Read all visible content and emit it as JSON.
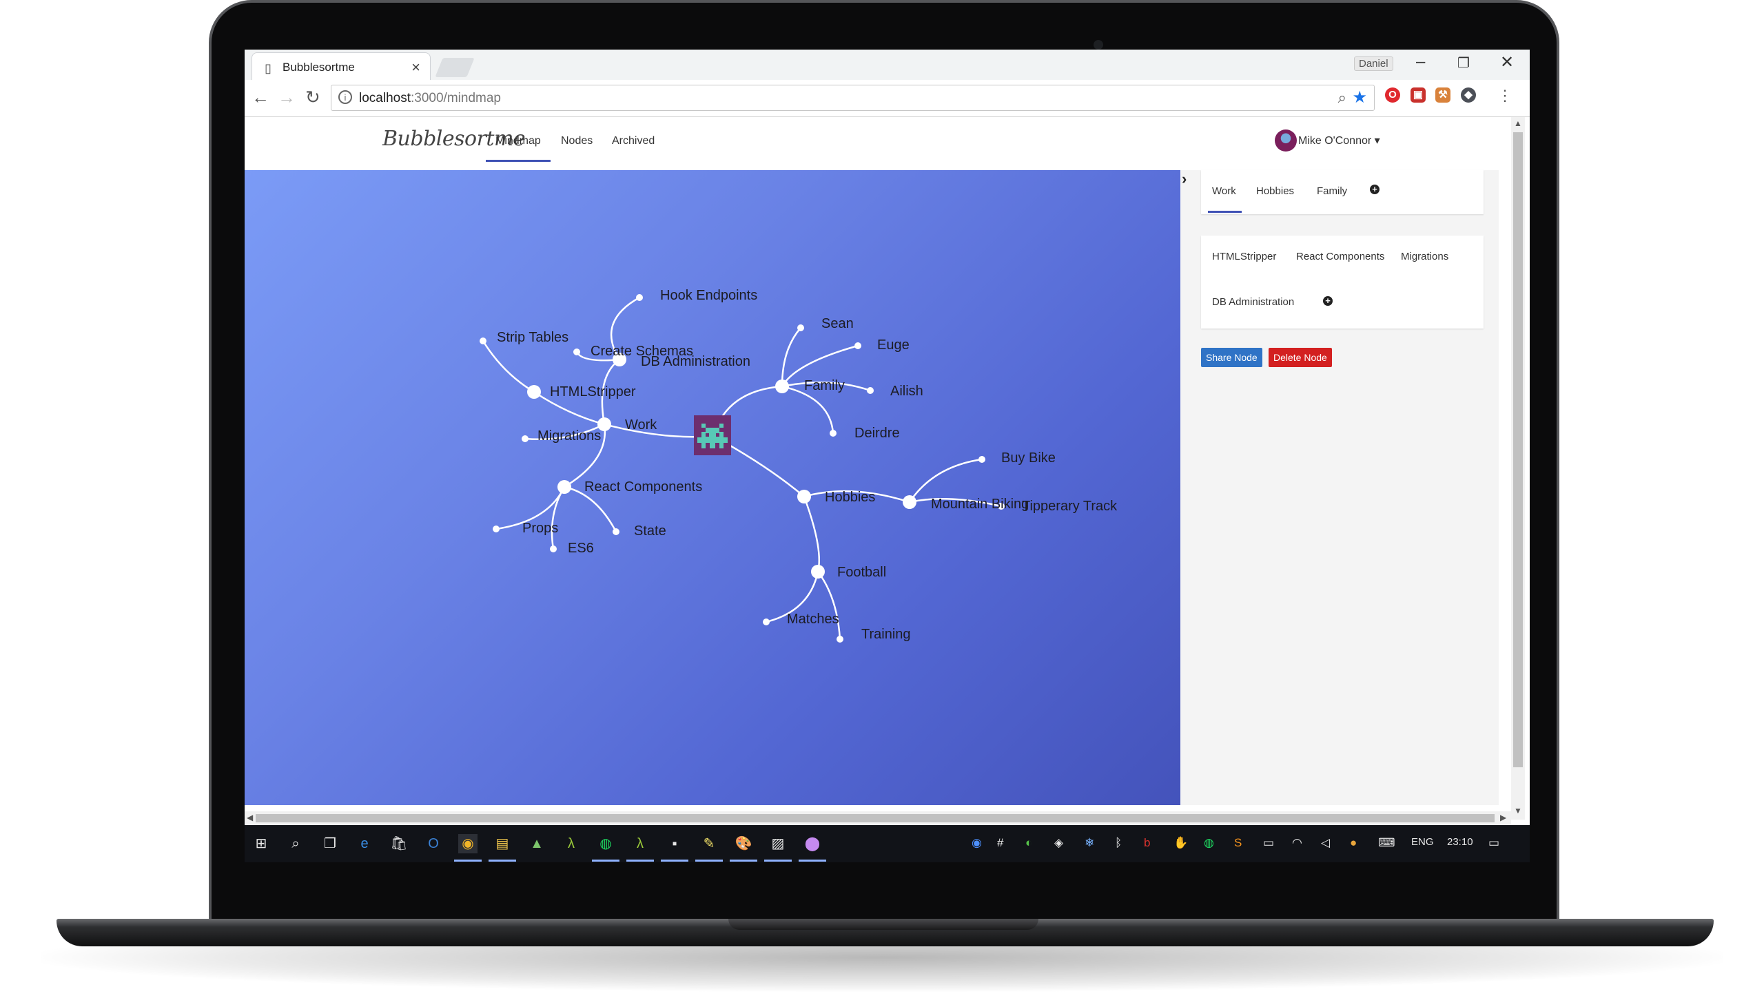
{
  "browser": {
    "tab_title": "Bubblesortme",
    "tab_favicon": "bookmark-b-icon",
    "profile_name": "Daniel",
    "url_host": "localhost",
    "url_rest": ":3000/mindmap",
    "window_controls": [
      "minimize-icon",
      "restore-icon",
      "close-icon"
    ],
    "extensions": [
      "opera-icon",
      "pdf-icon",
      "hammer-icon",
      "shield-icon"
    ]
  },
  "app": {
    "logo": "Bubblesortme",
    "nav": [
      {
        "label": "Mindmap",
        "active": true
      },
      {
        "label": "Nodes",
        "active": false
      },
      {
        "label": "Archived",
        "active": false
      }
    ],
    "user_name": "Mike O'Connor",
    "user_caret": "▾"
  },
  "mindmap": {
    "root_icon": "space-invader-icon",
    "colors": {
      "background_start": "#7b9bf6",
      "background_end": "#4453bb",
      "line": "#ffffff",
      "root": "#6d2e6e"
    },
    "nodes": {
      "work": "Work",
      "db_administration": "DB Administration",
      "hook_endpoints": "Hook Endpoints",
      "create_schemas": "Create Schemas",
      "strip_tables": "Strip Tables",
      "htmlstripper": "HTMLStripper",
      "migrations": "Migrations",
      "react_components": "React Components",
      "props": "Props",
      "es6": "ES6",
      "state": "State",
      "family": "Family",
      "sean": "Sean",
      "euge": "Euge",
      "ailish": "Ailish",
      "deirdre": "Deirdre",
      "hobbies": "Hobbies",
      "mountain_biking": "Mountain Biking",
      "buy_bike": "Buy Bike",
      "tipperary_track": "Tipperary Track",
      "football": "Football",
      "matches": "Matches",
      "training": "Training"
    }
  },
  "panel": {
    "collapse_icon": "chevron-right-icon",
    "tabs": [
      {
        "label": "Work",
        "active": true
      },
      {
        "label": "Hobbies",
        "active": false
      },
      {
        "label": "Family",
        "active": false
      }
    ],
    "children": [
      "HTMLStripper",
      "React Components",
      "Migrations",
      "DB Administration"
    ],
    "add_icon": "+",
    "share_label": "Share Node",
    "delete_label": "Delete Node"
  },
  "taskbar": {
    "apps": [
      "windows-start-icon",
      "search-icon",
      "task-view-icon",
      "edge-icon",
      "store-icon",
      "outlook-icon",
      "chrome-icon",
      "file-explorer-icon",
      "android-studio-icon",
      "lambda-icon",
      "spotify-icon",
      "lambda-icon",
      "webstorm-icon",
      "notepad-icon",
      "paint-icon",
      "photos-icon",
      "maps-icon"
    ],
    "tray_icons": [
      "chrome-tray-icon",
      "slack-icon",
      "evernote-icon",
      "dropbox-icon",
      "snowflake-icon",
      "bluetooth-icon",
      "beats-icon",
      "hand-icon",
      "spotify-tray-icon",
      "sublime-icon",
      "battery-icon",
      "wifi-icon",
      "volume-icon",
      "globe-icon",
      "keyboard-icon"
    ],
    "language": "ENG",
    "time": "23:10",
    "notifications_icon": "action-center-icon"
  }
}
